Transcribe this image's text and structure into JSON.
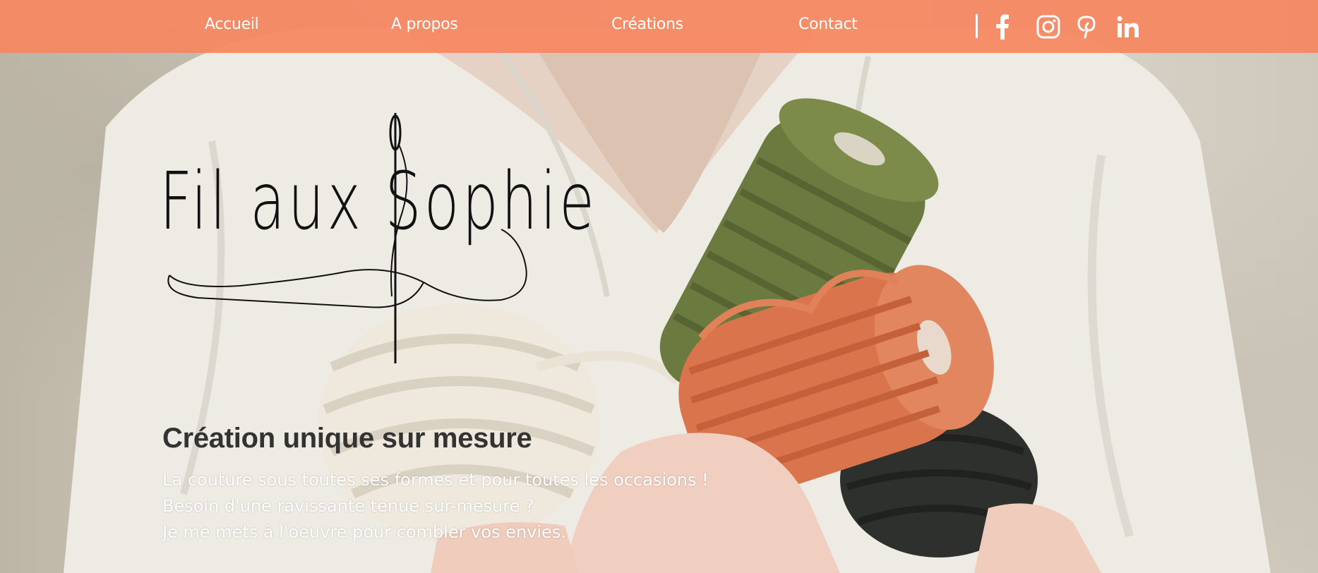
{
  "nav": {
    "links": [
      {
        "label": "Accueil"
      },
      {
        "label": "A propos"
      },
      {
        "label": "Créations"
      },
      {
        "label": "Contact"
      }
    ],
    "social": [
      {
        "icon": "facebook-icon"
      },
      {
        "icon": "instagram-icon"
      },
      {
        "icon": "pinterest-icon"
      },
      {
        "icon": "linkedin-icon"
      }
    ]
  },
  "logo": {
    "text": "Fil aux Sophie"
  },
  "hero": {
    "title": "Création unique sur mesure",
    "lines": [
      "La couture sous toutes ses formes et pour toutes les occasions !",
      "Besoin d'une ravissante tenue sur-mesure ?",
      "Je me mets à l'oeuvre pour combler vos envies."
    ]
  },
  "colors": {
    "nav_background": "#f68661",
    "nav_text": "#ffffff",
    "title_text": "#333333",
    "body_text": "#ffffff"
  }
}
